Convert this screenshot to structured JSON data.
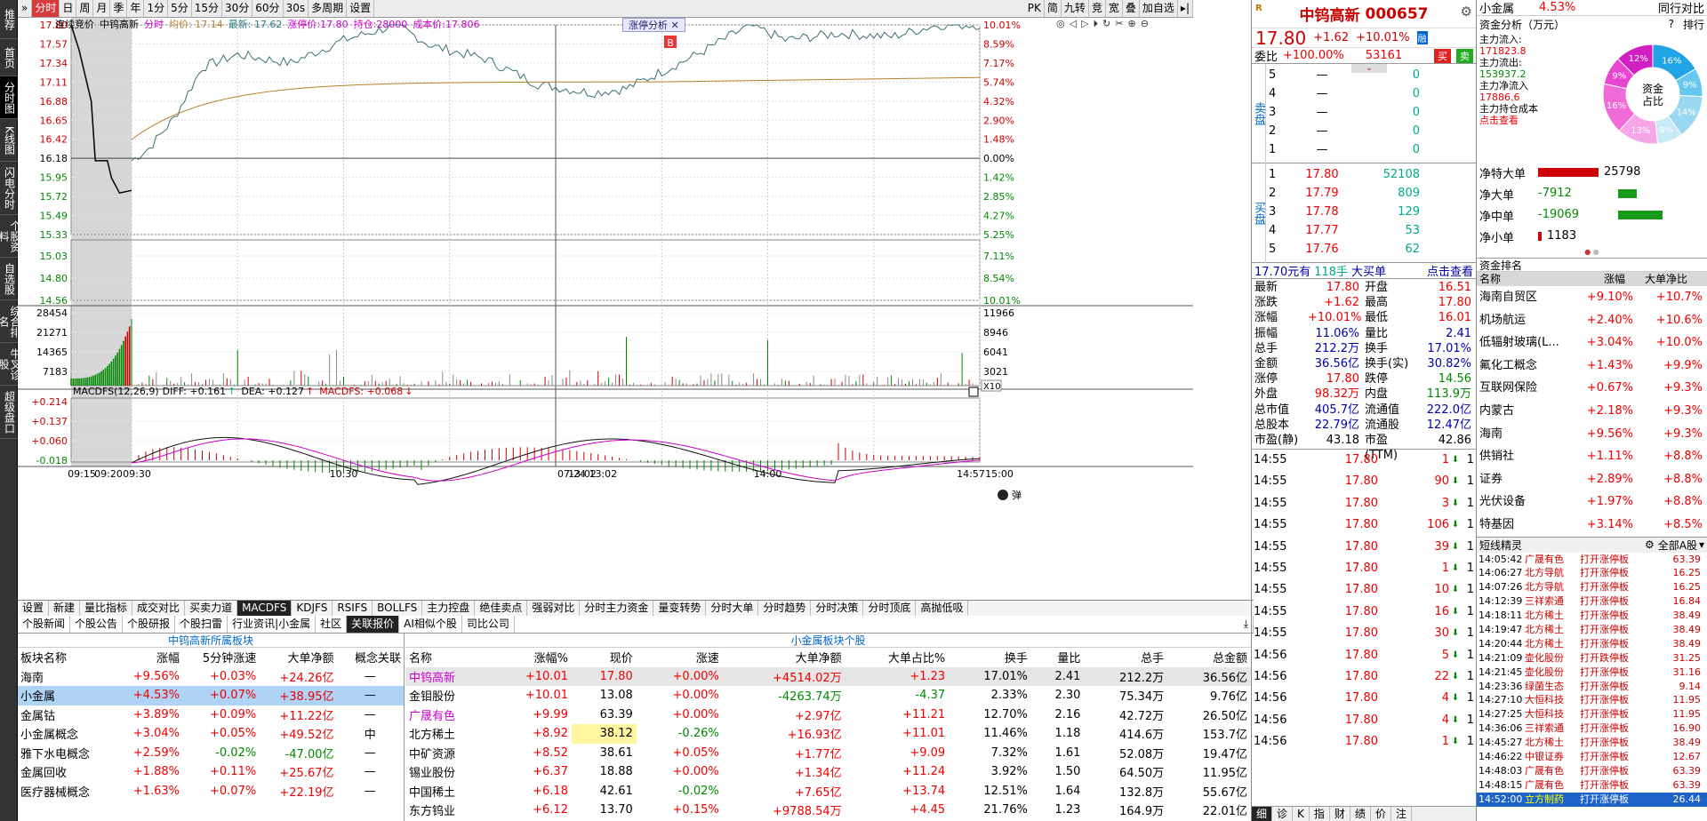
{
  "left_nav": [
    "推荐",
    "首页",
    "分时图",
    "K线图",
    "闪电分时",
    "个股资料",
    "自选股",
    "综合排名",
    "牛叉诊股",
    "超级盘口"
  ],
  "toolbar": {
    "left": [
      "分时",
      "日",
      "周",
      "月",
      "季",
      "年",
      "1分",
      "5分",
      "15分",
      "30分",
      "60分",
      "30s",
      "多周期",
      "设置"
    ],
    "right": [
      "PK",
      "简",
      "九转",
      "竞",
      "宽",
      "叠",
      "加自选"
    ]
  },
  "chart": {
    "status": {
      "mode": "连续竞价",
      "name": "中钨高新",
      "fenshi": "分时",
      "avg_label": "均价: 17.14",
      "last_label": "最新: 17.62",
      "zt_label": "涨停价:17.80",
      "pos_label": "持仓:28000",
      "cost_label": "成本价:17.806",
      "zt_tag": "涨停分析"
    },
    "price_left": [
      "17.80",
      "17.57",
      "17.34",
      "17.11",
      "16.88",
      "16.65",
      "16.42",
      "16.18",
      "15.95",
      "15.72",
      "15.49",
      "15.33"
    ],
    "price_right": [
      "10.01%",
      "8.59%",
      "7.17%",
      "5.74%",
      "4.32%",
      "2.90%",
      "1.48%",
      "0.00%",
      "1.42%",
      "2.85%",
      "4.27%",
      "5.25%"
    ],
    "low_left": [
      "15.03",
      "14.80",
      "14.56"
    ],
    "low_right": [
      "7.11%",
      "8.54%",
      "10.01%"
    ],
    "vol_left": [
      "28454",
      "21271",
      "14365",
      "7183"
    ],
    "vol_right": [
      "11966",
      "8946",
      "6041",
      "3021"
    ],
    "vol_x": "X10",
    "macd_label": "MACDFS(12,26,9)",
    "diff_label": "DIFF: +0.161",
    "dea_label": "DEA: +0.127",
    "macdfs_label": "MACDFS: +0.068",
    "macd_left": [
      "+0.214",
      "+0.137",
      "+0.060",
      "-0.018"
    ],
    "time_ticks": [
      "09:15",
      "09:20",
      "09:30",
      "10:30",
      "13:02",
      "14:00",
      "14:57",
      "15:00"
    ],
    "cursor_label": "07-24 13:02",
    "bs_mark": "B",
    "tan": "弹",
    "colors": {
      "price": "#3a6f73",
      "avg": "#b5822a",
      "up": "#e00000",
      "down": "#008000"
    }
  },
  "subtabs": [
    "设置",
    "新建",
    "量比指标",
    "成交对比",
    "买卖力道",
    "MACDFS",
    "KDJFS",
    "RSIFS",
    "BOLLFS",
    "主力控盘",
    "绝佳卖点",
    "强弱对比",
    "分时主力资金",
    "量变转势",
    "分时大单",
    "分时趋势",
    "分时决策",
    "分时顶底",
    "高抛低吸"
  ],
  "info_tabs": [
    "个股新闻",
    "个股公告",
    "个股研报",
    "个股扫雷",
    "行业资讯|小金属",
    "社区",
    "关联报价",
    "AI相似个股",
    "司比公司"
  ],
  "sector_table": {
    "title": "中钨高新所属板块",
    "headers": [
      "板块名称",
      "涨幅",
      "5分钟涨速",
      "大单净额",
      "概念关联"
    ],
    "rows": [
      [
        "海南",
        "+9.56%",
        "+0.03%",
        "+24.26亿",
        "—"
      ],
      [
        "小金属",
        "+4.53%",
        "+0.07%",
        "+38.95亿",
        "—"
      ],
      [
        "金属钴",
        "+3.89%",
        "+0.09%",
        "+11.22亿",
        "—"
      ],
      [
        "小金属概念",
        "+3.04%",
        "+0.05%",
        "+49.52亿",
        "中"
      ],
      [
        "雅下水电概念",
        "+2.59%",
        "-0.02%",
        "-47.00亿",
        "—"
      ],
      [
        "金属回收",
        "+1.88%",
        "+0.11%",
        "+25.67亿",
        "—"
      ],
      [
        "医疗器械概念",
        "+1.63%",
        "+0.07%",
        "+22.19亿",
        "—"
      ]
    ]
  },
  "stock_table": {
    "title": "小金属板块个股",
    "headers": [
      "名称",
      "涨幅%",
      "现价",
      "涨速",
      "大单净额",
      "大单占比%",
      "换手",
      "量比",
      "总手",
      "总金额"
    ],
    "rows": [
      [
        "中钨高新",
        "+10.01",
        "17.80",
        "+0.00%",
        "+4514.02万",
        "+1.23",
        "17.01%",
        "2.41",
        "212.2万",
        "36.56亿"
      ],
      [
        "金钼股份",
        "+10.01",
        "13.08",
        "+0.00%",
        "-4263.74万",
        "-4.37",
        "2.33%",
        "2.30",
        "75.34万",
        "9.76亿"
      ],
      [
        "广晟有色",
        "+9.99",
        "63.39",
        "+0.00%",
        "+2.97亿",
        "+11.21",
        "12.70%",
        "2.16",
        "42.72万",
        "26.50亿"
      ],
      [
        "北方稀土",
        "+8.92",
        "38.12",
        "-0.26%",
        "+16.93亿",
        "+11.01",
        "11.46%",
        "1.18",
        "414.6万",
        "153.7亿"
      ],
      [
        "中矿资源",
        "+8.52",
        "38.61",
        "+0.05%",
        "+1.77亿",
        "+9.09",
        "7.32%",
        "1.61",
        "52.08万",
        "19.47亿"
      ],
      [
        "锡业股份",
        "+6.37",
        "18.88",
        "+0.00%",
        "+1.34亿",
        "+11.24",
        "3.92%",
        "1.50",
        "64.50万",
        "11.95亿"
      ],
      [
        "中国稀土",
        "+6.18",
        "42.61",
        "-0.02%",
        "+7.65亿",
        "+13.74",
        "12.51%",
        "1.64",
        "132.8万",
        "55.67亿"
      ],
      [
        "东方钨业",
        "+6.12",
        "13.70",
        "+0.15%",
        "+9788.54万",
        "+4.45",
        "21.76%",
        "1.23",
        "164.9万",
        "22.01亿"
      ]
    ]
  },
  "quote": {
    "name": "中钨高新",
    "code": "000657",
    "price": "17.80",
    "change": "+1.62",
    "pct": "+10.01%",
    "rong": "融",
    "weibi_label": "委比",
    "weibi": "+100.00%",
    "weicha": "53161",
    "buy": "买",
    "sell": "卖",
    "sell_label": "卖盘",
    "buy_label": "买盘",
    "asks": [
      [
        "5",
        "—",
        "0"
      ],
      [
        "4",
        "—",
        "0"
      ],
      [
        "3",
        "—",
        "0"
      ],
      [
        "2",
        "—",
        "0"
      ],
      [
        "1",
        "—",
        "0"
      ]
    ],
    "bids": [
      [
        "1",
        "17.80",
        "52108"
      ],
      [
        "2",
        "17.79",
        "809"
      ],
      [
        "3",
        "17.78",
        "129"
      ],
      [
        "4",
        "17.77",
        "53"
      ],
      [
        "5",
        "17.76",
        "62"
      ]
    ],
    "bigorder": {
      "price": "17.70元有",
      "vol": "118手",
      "kind": "大买单",
      "link": "点击查看"
    },
    "stats": [
      [
        "最新",
        "17.80",
        "开盘",
        "16.51"
      ],
      [
        "涨跌",
        "+1.62",
        "最高",
        "17.80"
      ],
      [
        "涨幅",
        "+10.01%",
        "最低",
        "16.01"
      ],
      [
        "振幅",
        "11.06%",
        "量比",
        "2.41"
      ],
      [
        "总手",
        "212.2万",
        "换手",
        "17.01%"
      ],
      [
        "金额",
        "36.56亿",
        "换手(实)",
        "30.82%"
      ],
      [
        "涨停",
        "17.80",
        "跌停",
        "14.56"
      ],
      [
        "外盘",
        "98.32万",
        "内盘",
        "113.9万"
      ],
      [
        "总市值",
        "405.7亿",
        "流通值",
        "222.0亿"
      ],
      [
        "总股本",
        "22.79亿",
        "流通股",
        "12.47亿"
      ],
      [
        "市盈(静)",
        "43.18",
        "市盈(TTM)",
        "42.86"
      ]
    ],
    "ticks": [
      [
        "14:55",
        "17.80",
        "1"
      ],
      [
        "14:55",
        "17.80",
        "90"
      ],
      [
        "14:55",
        "17.80",
        "3"
      ],
      [
        "14:55",
        "17.80",
        "106"
      ],
      [
        "14:55",
        "17.80",
        "39"
      ],
      [
        "14:55",
        "17.80",
        "1"
      ],
      [
        "14:55",
        "17.80",
        "10"
      ],
      [
        "14:55",
        "17.80",
        "16"
      ],
      [
        "14:55",
        "17.80",
        "30"
      ],
      [
        "14:56",
        "17.80",
        "5"
      ],
      [
        "14:56",
        "17.80",
        "22"
      ],
      [
        "14:56",
        "17.80",
        "4"
      ],
      [
        "14:56",
        "17.80",
        "4"
      ],
      [
        "14:56",
        "17.80",
        "1"
      ]
    ],
    "bottom_tabs": [
      "细",
      "诊",
      "K",
      "指",
      "财",
      "绩",
      "价",
      "注"
    ]
  },
  "funds": {
    "sector": "小金属",
    "sector_pct": "4.53%",
    "tongxing": "同行对比",
    "title": "资金分析（万元）",
    "help": "?",
    "tab": "排行",
    "inflow_label": "主力流入:",
    "inflow": "171823.8",
    "outflow_label": "主力流出:",
    "outflow": "153937.2",
    "net_label": "主力净流入",
    "net": "17886.6",
    "cost_label": "主力持仓成本",
    "cost_link": "点击查看",
    "donut_center": "资金占比",
    "donut": [
      {
        "pct": "16%",
        "value": 16,
        "color": "#22a3e6"
      },
      {
        "pct": "9%",
        "value": 9,
        "color": "#66c7f0"
      },
      {
        "pct": "14%",
        "value": 14,
        "color": "#9ad8f2"
      },
      {
        "pct": "8%",
        "value": 8,
        "color": "#c7eaf8"
      },
      {
        "pct": "13%",
        "value": 13,
        "color": "#f5a6e6"
      },
      {
        "pct": "16%",
        "value": 16,
        "color": "#f06ad8"
      },
      {
        "pct": "9%",
        "value": 9,
        "color": "#e845d0"
      },
      {
        "pct": "12%",
        "value": 12,
        "color": "#d11fc1"
      }
    ],
    "net_rows": [
      {
        "label": "净特大单",
        "value": "25798",
        "bar": 0.72,
        "color": "#c00"
      },
      {
        "label": "净大单",
        "value": "-7912",
        "bar": 0.22,
        "color": "#1a9a1a"
      },
      {
        "label": "净中单",
        "value": "-19069",
        "bar": 0.53,
        "color": "#1a9a1a"
      },
      {
        "label": "净小单",
        "value": "1183",
        "bar": 0.04,
        "color": "#c00"
      }
    ],
    "rank_title": "资金排名",
    "rank_headers": [
      "名称",
      "涨幅",
      "大单净比"
    ],
    "ranks": [
      [
        "海南自贸区",
        "+9.10%",
        "+10.7%"
      ],
      [
        "机场航运",
        "+2.40%",
        "+10.6%"
      ],
      [
        "低辐射玻璃(L...",
        "+3.04%",
        "+10.0%"
      ],
      [
        "氟化工概念",
        "+1.43%",
        "+9.9%"
      ],
      [
        "互联网保险",
        "+0.67%",
        "+9.3%"
      ],
      [
        "内蒙古",
        "+2.18%",
        "+9.3%"
      ],
      [
        "海南",
        "+9.56%",
        "+9.3%"
      ],
      [
        "供销社",
        "+1.11%",
        "+8.8%"
      ],
      [
        "证券",
        "+2.89%",
        "+8.8%"
      ],
      [
        "光伏设备",
        "+1.97%",
        "+8.8%"
      ],
      [
        "特基因",
        "+3.14%",
        "+8.5%"
      ]
    ],
    "jx_title": "短线精灵",
    "jx_scope": "全部A股",
    "jx": [
      [
        "14:05:42",
        "广晟有色",
        "打开涨停板",
        "63.39"
      ],
      [
        "14:06:27",
        "北方导航",
        "打开涨停板",
        "16.25"
      ],
      [
        "14:07:26",
        "北方导航",
        "打开涨停板",
        "16.25"
      ],
      [
        "14:12:39",
        "三祥索通",
        "打开涨停板",
        "16.84"
      ],
      [
        "14:18:11",
        "北方稀土",
        "打开涨停板",
        "38.49"
      ],
      [
        "14:19:47",
        "北方稀土",
        "打开涨停板",
        "38.49"
      ],
      [
        "14:20:44",
        "北方稀土",
        "打开涨停板",
        "38.49"
      ],
      [
        "14:21:09",
        "壶化股份",
        "打开跌停板",
        "31.25"
      ],
      [
        "14:21:45",
        "壶化股份",
        "打开涨停板",
        "31.16"
      ],
      [
        "14:23:36",
        "绿菌生态",
        "打开涨停板",
        "9.14"
      ],
      [
        "14:27:10",
        "大恒科技",
        "打开涨停板",
        "11.95"
      ],
      [
        "14:27:25",
        "大恒科技",
        "打开涨停板",
        "11.95"
      ],
      [
        "14:36:06",
        "三祥索通",
        "打开涨停板",
        "16.90"
      ],
      [
        "14:45:27",
        "北方稀土",
        "打开涨停板",
        "38.49"
      ],
      [
        "14:46:22",
        "中银证券",
        "打开涨停板",
        "12.67"
      ],
      [
        "14:48:03",
        "广晟有色",
        "打开涨停板",
        "63.39"
      ],
      [
        "14:48:15",
        "广晟有色",
        "打开涨停板",
        "63.39"
      ],
      [
        "14:52:00",
        "立方制药",
        "打开涨停板",
        "26.44"
      ]
    ]
  }
}
